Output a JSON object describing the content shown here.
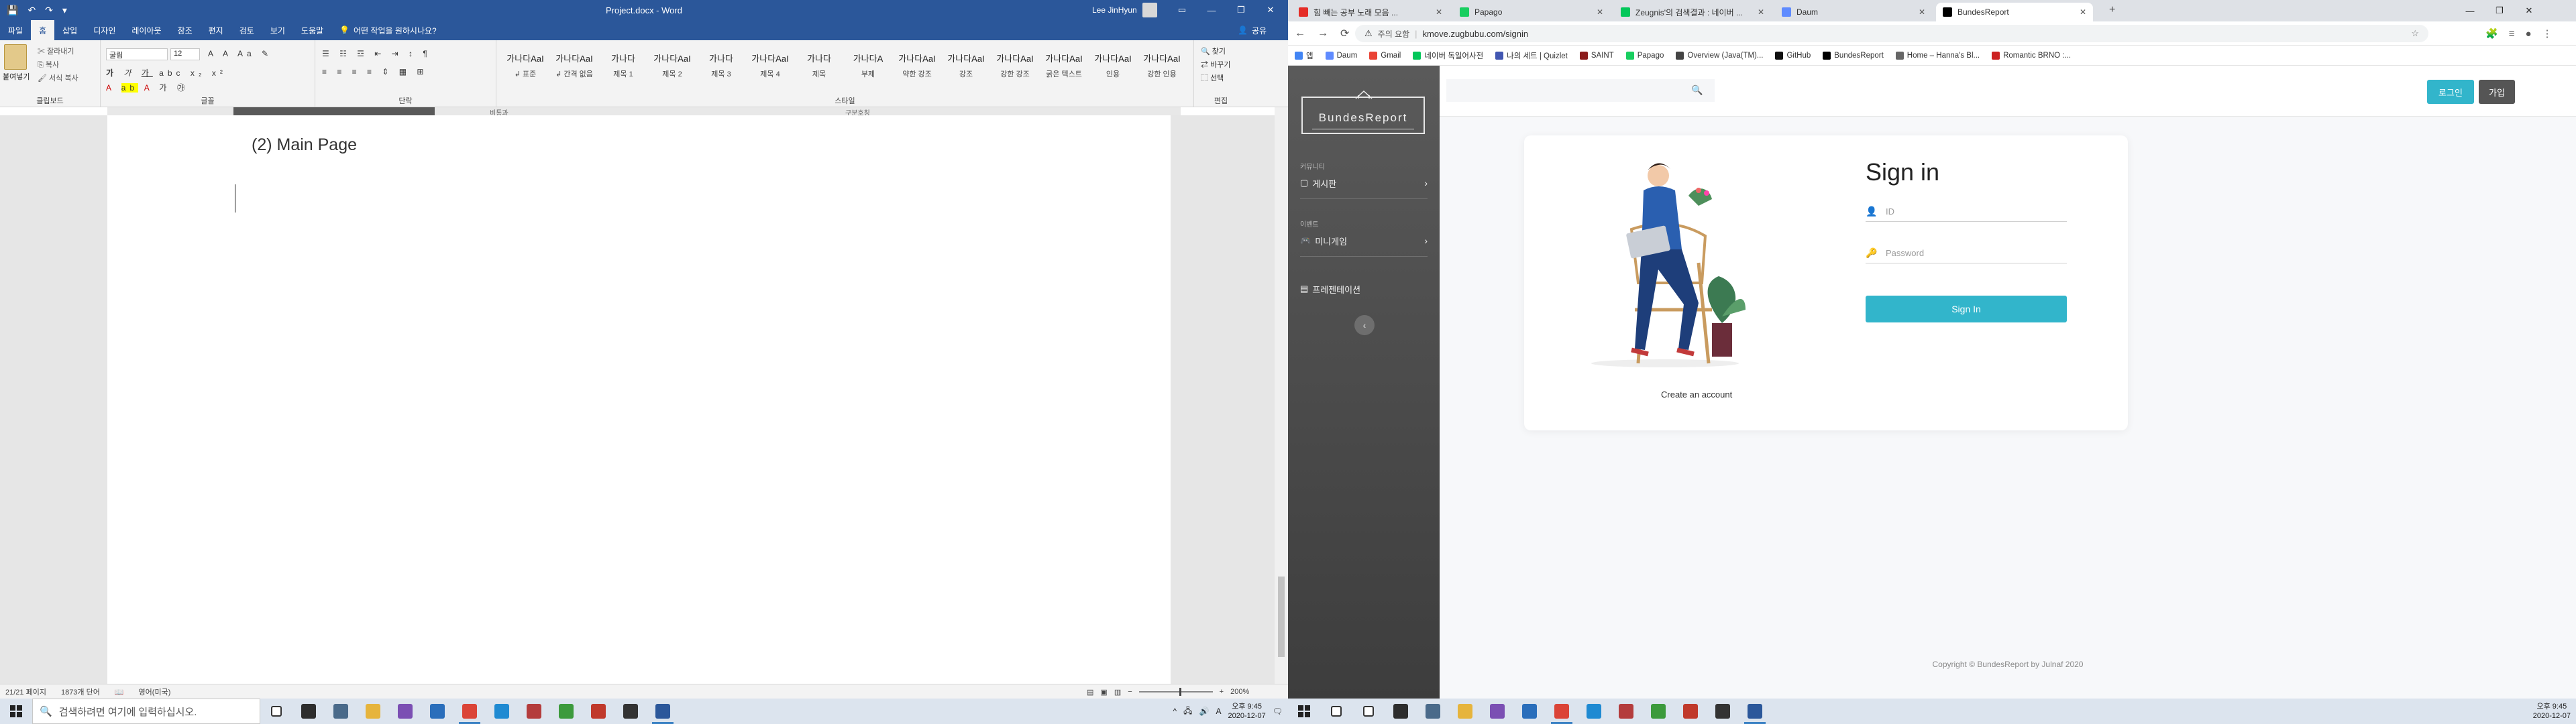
{
  "word": {
    "title": "Project.docx - Word",
    "user": "Lee JinHyun",
    "quick_access": [
      "💾",
      "↶",
      "↷",
      "▾"
    ],
    "menu_tabs": [
      "파일",
      "홈",
      "삽입",
      "디자인",
      "레이아웃",
      "참조",
      "편지",
      "검토",
      "보기",
      "도움말"
    ],
    "active_tab": "홈",
    "tell_me": "어떤 작업을 원하시나요?",
    "share": "공유",
    "clipboard": {
      "paste": "붙여넣기",
      "cut": "잘라내기",
      "copy": "복사",
      "format_painter": "서식 복사",
      "group": "클립보드"
    },
    "font": {
      "name": "굴림",
      "size": "12",
      "group": "글꼴"
    },
    "paragraph_group": "단락",
    "styles_group": "스타일",
    "styles": [
      {
        "sample": "가나다AaI",
        "name": "↲ 표준"
      },
      {
        "sample": "가나다AaI",
        "name": "↲ 간격 없음"
      },
      {
        "sample": "가나다",
        "name": "제목 1"
      },
      {
        "sample": "가나다AaI",
        "name": "제목 2"
      },
      {
        "sample": "가나다",
        "name": "제목 3"
      },
      {
        "sample": "가나다AaI",
        "name": "제목 4"
      },
      {
        "sample": "가나다",
        "name": "제목"
      },
      {
        "sample": "가나다A",
        "name": "부제"
      },
      {
        "sample": "가나다AaI",
        "name": "약한 강조"
      },
      {
        "sample": "가나다AaI",
        "name": "강조"
      },
      {
        "sample": "가나다AaI",
        "name": "강한 강조"
      },
      {
        "sample": "가나다AaI",
        "name": "굵은 텍스트"
      },
      {
        "sample": "가나다AaI",
        "name": "인용"
      },
      {
        "sample": "가나다AaI",
        "name": "강한 인용"
      }
    ],
    "editing": {
      "find": "찾기",
      "replace": "바꾸기",
      "select": "선택",
      "group": "편집"
    },
    "ruler_labels": [
      "비통과",
      "구분호칭"
    ],
    "heading": "(2) Main Page",
    "status": {
      "page": "21/21 페이지",
      "words": "1873개 단어",
      "lang": "영어(미국)",
      "zoom": "200%"
    }
  },
  "taskbar_left": {
    "search_placeholder": "검색하려면 여기에 입력하십시오.",
    "clock_time": "오후 9:45",
    "clock_date": "2020-12-07",
    "lang_indicator": "A",
    "apps": [
      {
        "name": "task-view",
        "color": "#ffffff"
      },
      {
        "name": "app-1",
        "color": "#2d2d2d"
      },
      {
        "name": "app-2",
        "color": "#4a6a8a"
      },
      {
        "name": "explorer",
        "color": "#e6b43c"
      },
      {
        "name": "visual-studio",
        "color": "#7b4fb3"
      },
      {
        "name": "app-5",
        "color": "#2a6ebb"
      },
      {
        "name": "chrome",
        "color": "#db4437"
      },
      {
        "name": "vscode",
        "color": "#1f8ad2"
      },
      {
        "name": "app-8",
        "color": "#b43c3c"
      },
      {
        "name": "app-9",
        "color": "#3c9a3c"
      },
      {
        "name": "app-10",
        "color": "#c0392b"
      },
      {
        "name": "app-11",
        "color": "#333333"
      },
      {
        "name": "word",
        "color": "#2b579a"
      }
    ]
  },
  "taskbar_right": {
    "clock_time": "오후 9:45",
    "clock_date": "2020-12-07",
    "apps": [
      {
        "name": "search",
        "color": "#ffffff"
      },
      {
        "name": "task-view",
        "color": "#ffffff"
      },
      {
        "name": "app-1",
        "color": "#2d2d2d"
      },
      {
        "name": "app-2",
        "color": "#4a6a8a"
      },
      {
        "name": "explorer",
        "color": "#e6b43c"
      },
      {
        "name": "visual-studio",
        "color": "#7b4fb3"
      },
      {
        "name": "app-5",
        "color": "#2a6ebb"
      },
      {
        "name": "chrome",
        "color": "#db4437"
      },
      {
        "name": "vscode",
        "color": "#1f8ad2"
      },
      {
        "name": "app-8",
        "color": "#b43c3c"
      },
      {
        "name": "app-9",
        "color": "#3c9a3c"
      },
      {
        "name": "app-10",
        "color": "#c0392b"
      },
      {
        "name": "app-11",
        "color": "#333333"
      },
      {
        "name": "word",
        "color": "#2b579a"
      }
    ]
  },
  "chrome": {
    "tabs": [
      {
        "label": "힘 빼는 공부 노래 모음 ...",
        "fav": "#e52d27"
      },
      {
        "label": "Papago",
        "fav": "#19ce60"
      },
      {
        "label": "Zeugnis'의 검색결과 : 네이버 ...",
        "fav": "#03c75a"
      },
      {
        "label": "Daum",
        "fav": "#5f8bff"
      },
      {
        "label": "BundesReport",
        "fav": "#000000"
      }
    ],
    "new_tab": "+",
    "security": "주의 요함",
    "url": "kmove.zugbubu.com/signin",
    "bookmarks": [
      {
        "label": "앱",
        "color": "#4285f4"
      },
      {
        "label": "Daum",
        "color": "#5f8bff"
      },
      {
        "label": "Gmail",
        "color": "#ea4335"
      },
      {
        "label": "네이버 독일어사전",
        "color": "#03c75a"
      },
      {
        "label": "나의 세트 | Quizlet",
        "color": "#4257b2"
      },
      {
        "label": "SAINT",
        "color": "#8b1c1c"
      },
      {
        "label": "Papago",
        "color": "#19ce60"
      },
      {
        "label": "Overview (Java(TM)...",
        "color": "#444444"
      },
      {
        "label": "GitHub",
        "color": "#111111"
      },
      {
        "label": "BundesReport",
        "color": "#000000"
      },
      {
        "label": "Home – Hanna's Bl...",
        "color": "#666666"
      },
      {
        "label": "Romantic BRNO :...",
        "color": "#cc2222"
      }
    ]
  },
  "site": {
    "brand": "BundesReport",
    "sections": [
      {
        "header": "커뮤니티",
        "item": "게시판"
      },
      {
        "header": "이벤트",
        "item": "미니게임"
      }
    ],
    "extra_item": "프레젠테이션",
    "toggle": "‹",
    "login_button": "로그인",
    "join_button": "가입",
    "accent": "#32b5cb",
    "signin_title": "Sign in",
    "id_placeholder": "ID",
    "password_placeholder": "Password",
    "signin_button": "Sign In",
    "create_account": "Create an account",
    "copyright": "Copyright © BundesReport by Julnaf 2020"
  }
}
